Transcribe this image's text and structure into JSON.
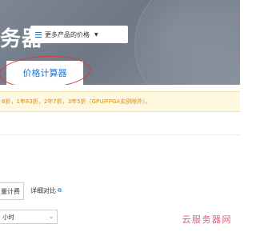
{
  "header": {
    "title": "务器",
    "more_products_label": "更多产品的价格"
  },
  "tabs": [
    {
      "label": "价格计算器",
      "active": true
    }
  ],
  "notice": {
    "text": "8折，1年83折，2年7折，3年5折（GPU/FPGA实例除外）。"
  },
  "billing": {
    "mode_label": "量计费",
    "compare_link": "详细对比"
  },
  "duration_select": {
    "value": "小时"
  },
  "watermark": "云服务器网",
  "colors": {
    "accent": "#1a76d2",
    "notice_text": "#d88a16",
    "highlight_circle": "#d9383a"
  },
  "icons": [
    "list-icon",
    "caret-down-icon",
    "external-link-icon",
    "chevron-down-icon"
  ]
}
